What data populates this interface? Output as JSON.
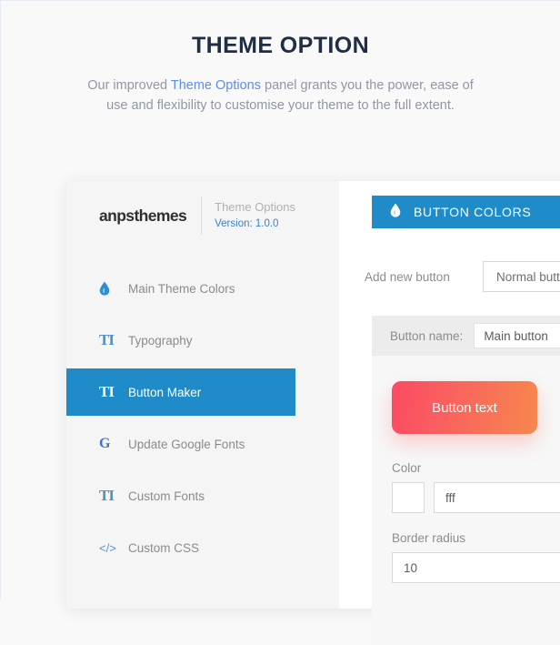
{
  "hero": {
    "title": "THEME OPTION",
    "desc_before": "Our improved ",
    "desc_link": "Theme Options",
    "desc_after": " panel grants you the power, ease of use and flexibility to customise your theme to the full extent."
  },
  "brand": {
    "logo": "anpsthemes",
    "product": "Theme Options",
    "version": "Version: 1.0.0"
  },
  "sidebar": {
    "items": [
      {
        "label": "Main Theme Colors",
        "icon": "droplet-icon",
        "glyph": "◆",
        "active": false
      },
      {
        "label": "Typography",
        "icon": "text-format-icon",
        "glyph": "TI",
        "active": false
      },
      {
        "label": "Button Maker",
        "icon": "text-format-icon",
        "glyph": "TI",
        "active": true
      },
      {
        "label": "Update Google Fonts",
        "icon": "google-icon",
        "glyph": "G",
        "active": false
      },
      {
        "label": "Custom Fonts",
        "icon": "text-format-icon",
        "glyph": "TI",
        "active": false
      },
      {
        "label": "Custom CSS",
        "icon": "code-icon",
        "glyph": "</>",
        "active": false
      }
    ]
  },
  "content": {
    "section_title": "BUTTON COLORS",
    "section_icon": "droplet-icon",
    "add_new_label": "Add new button",
    "add_new_value": "Normal button",
    "button_name_label": "Button name:",
    "button_name_value": "Main button",
    "preview_text": "Button text",
    "color_label": "Color",
    "color_value": "fff",
    "color_swatch": "#ffffff",
    "border_radius_label": "Border radius",
    "border_radius_value": "10"
  },
  "colors": {
    "accent_blue": "#1f8bc9",
    "link_blue": "#5b8def",
    "gradient_start": "#fb4a63",
    "gradient_end": "#f7874e",
    "heading": "#1d2e45",
    "sidebar_bg": "#f5f5f5"
  }
}
